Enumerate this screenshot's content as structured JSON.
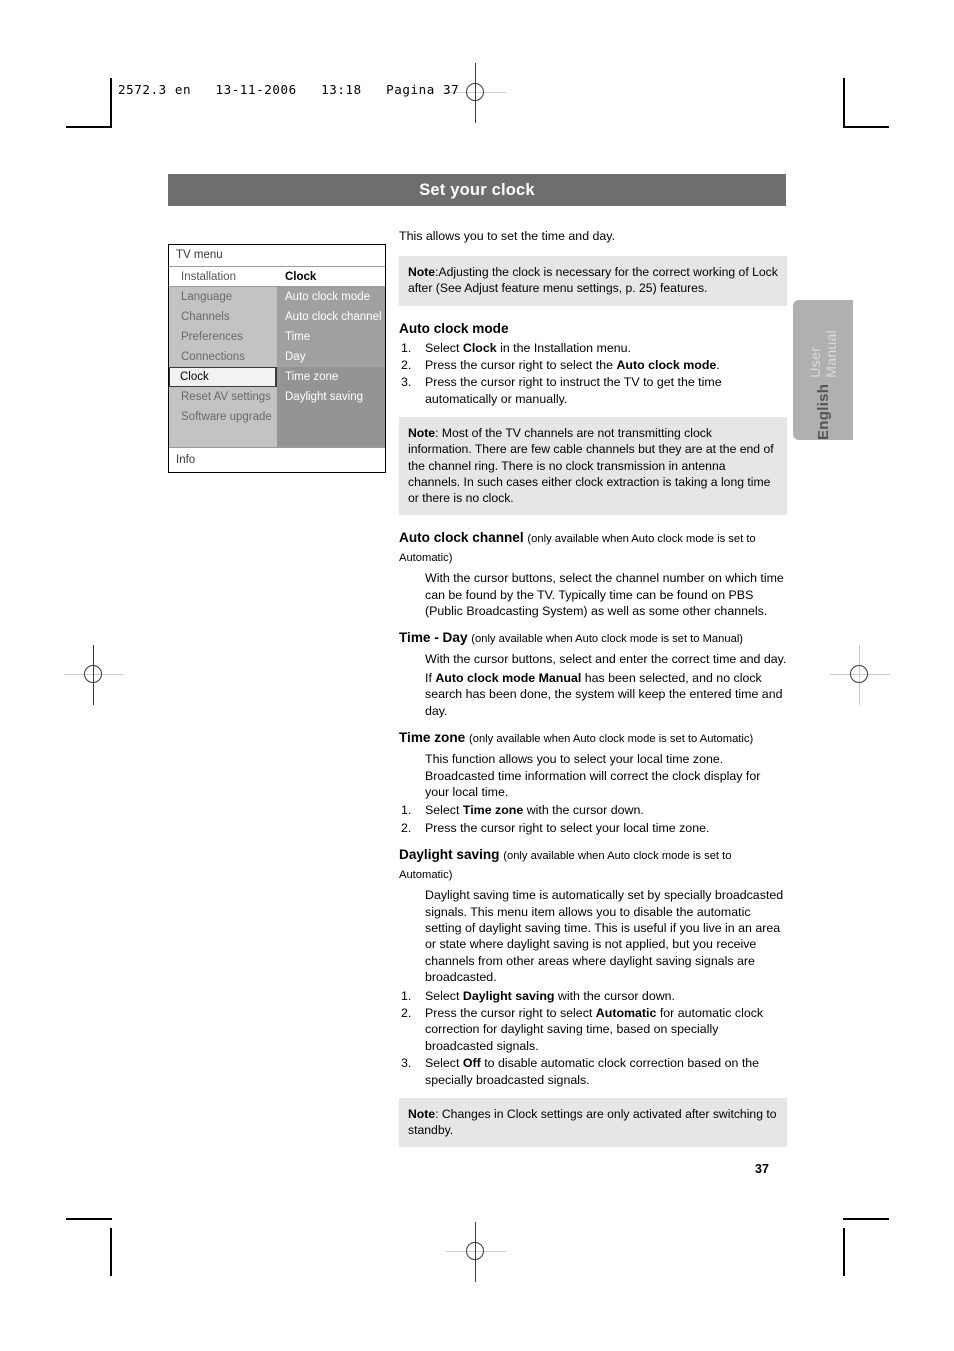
{
  "prepress": {
    "slug": "2572.3 en   13-11-2006   13:18   Pagina 37"
  },
  "header": {
    "title": "Set your clock"
  },
  "side_tab": {
    "language": "English",
    "manual": "User Manual"
  },
  "tv_menu": {
    "title": "TV menu",
    "info": "Info",
    "left_column": [
      {
        "label": "Installation",
        "style": "head"
      },
      {
        "label": "Language",
        "style": "item"
      },
      {
        "label": "Channels",
        "style": "item"
      },
      {
        "label": "Preferences",
        "style": "item"
      },
      {
        "label": "Connections",
        "style": "item"
      },
      {
        "label": "Clock",
        "style": "selected"
      },
      {
        "label": "Reset AV settings",
        "style": "item"
      },
      {
        "label": "Software upgrade",
        "style": "item"
      },
      {
        "label": "",
        "style": "blank"
      }
    ],
    "right_column": [
      {
        "label": "Clock",
        "style": "head"
      },
      {
        "label": "Auto clock mode",
        "style": "item"
      },
      {
        "label": "Auto clock channel",
        "style": "item"
      },
      {
        "label": "Time",
        "style": "item"
      },
      {
        "label": "Day",
        "style": "item"
      },
      {
        "label": "Time zone",
        "style": "item2"
      },
      {
        "label": "Daylight saving",
        "style": "item2"
      },
      {
        "label": "",
        "style": "blank"
      },
      {
        "label": "",
        "style": "blank"
      }
    ]
  },
  "content": {
    "intro": "This allows you to set the time and day.",
    "note_top": {
      "label": "Note",
      "text": ":Adjusting the clock is necessary for the correct working of Lock after (See Adjust feature menu settings, p. 25) features."
    },
    "auto_clock_mode": {
      "heading": "Auto clock mode",
      "steps": [
        {
          "num": "1.",
          "pre": "Select ",
          "bold": "Clock",
          "post": " in the Installation menu."
        },
        {
          "num": "2.",
          "pre": "Press the cursor right to select the ",
          "bold": "Auto clock mode",
          "post": "."
        },
        {
          "num": "3.",
          "pre": "Press the cursor right to instruct the TV to get the time automatically or manually.",
          "bold": "",
          "post": ""
        }
      ],
      "note": {
        "label": "Note",
        "text": ": Most of the TV channels are not transmitting clock information. There are few cable channels but they are at the end of the channel ring. There is no clock transmission in antenna channels. In such cases either clock extraction is taking a long time or there is no clock."
      }
    },
    "auto_clock_channel": {
      "heading": "Auto clock channel",
      "qualifier": "(only available when Auto clock mode is set to Automatic)",
      "body": "With the cursor buttons, select the channel number on which time can be found by the TV. Typically time can be found on PBS (Public Broadcasting System) as well as some other channels."
    },
    "time_day": {
      "heading": "Time - Day",
      "qualifier": "(only available when Auto clock mode is set to Manual)",
      "body1": "With the cursor buttons, select and enter the correct time and day.",
      "body2_pre": "If ",
      "body2_bold": "Auto clock mode Manual",
      "body2_post": " has been selected, and no clock search has been done, the system will keep the entered time and day."
    },
    "time_zone": {
      "heading": "Time zone",
      "qualifier": "(only available when Auto clock mode is set to Automatic)",
      "body": "This function allows you to select your local time zone. Broadcasted time information will correct the clock display for your local time.",
      "steps": [
        {
          "num": "1.",
          "pre": "Select ",
          "bold": "Time zone",
          "post": " with the cursor down."
        },
        {
          "num": "2.",
          "pre": "Press the cursor right to select your local time zone.",
          "bold": "",
          "post": ""
        }
      ]
    },
    "daylight_saving": {
      "heading": "Daylight saving",
      "qualifier": "(only available when Auto clock mode is set to Automatic)",
      "body": "Daylight saving time is automatically set by specially broadcasted signals. This menu item allows you to disable the automatic setting of daylight saving time. This is useful if you live in an area or state where daylight saving is not applied, but you receive channels from other areas where daylight saving signals are broadcasted.",
      "steps": [
        {
          "num": "1.",
          "pre": "Select ",
          "bold": "Daylight saving",
          "post": " with the cursor down."
        },
        {
          "num": "2.",
          "pre": "Press the cursor right to select ",
          "bold": "Automatic",
          "post": " for automatic clock correction for daylight saving time, based on specially broadcasted signals."
        },
        {
          "num": "3.",
          "pre": "Select ",
          "bold": "Off",
          "post": " to disable automatic clock correction based on the specially broadcasted signals."
        }
      ]
    },
    "note_bottom": {
      "label": "Note",
      "text": ": Changes in Clock settings are only activated after switching to standby."
    }
  },
  "footer": {
    "page_number": "37"
  }
}
